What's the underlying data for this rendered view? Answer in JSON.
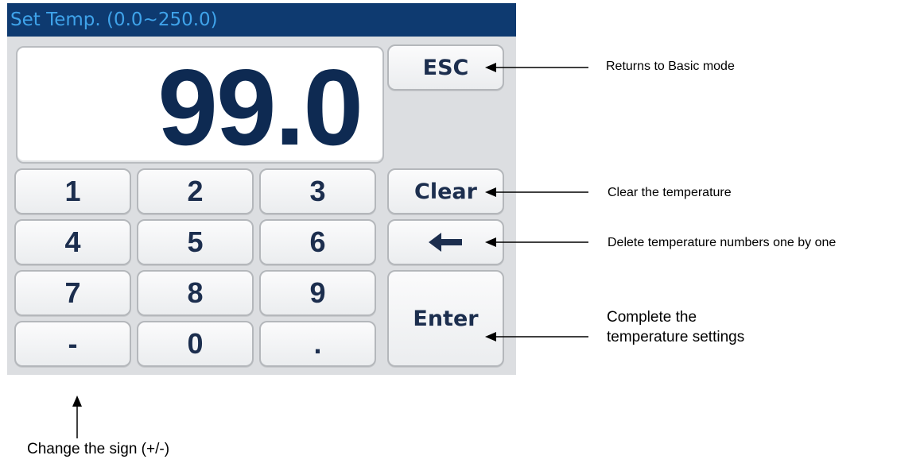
{
  "title": "Set Temp. (0.0~250.0)",
  "display_value": "99.0",
  "keys": {
    "k1": "1",
    "k2": "2",
    "k3": "3",
    "k4": "4",
    "k5": "5",
    "k6": "6",
    "k7": "7",
    "k8": "8",
    "k9": "9",
    "minus": "-",
    "k0": "0",
    "dot": "."
  },
  "function_keys": {
    "esc": "ESC",
    "clear": "Clear",
    "backspace_icon": "left-arrow-icon",
    "enter": "Enter"
  },
  "annotations": {
    "esc": "Returns to Basic mode",
    "clear": "Clear the temperature",
    "backspace": "Delete temperature numbers one by one",
    "enter_line1": "Complete the",
    "enter_line2": "temperature settings",
    "sign": "Change the sign (+/-)"
  },
  "colors": {
    "title_bar": "#0e3a70",
    "title_text": "#3fa3ea",
    "panel": "#dcdee1",
    "key_text": "#1c2e4e"
  }
}
